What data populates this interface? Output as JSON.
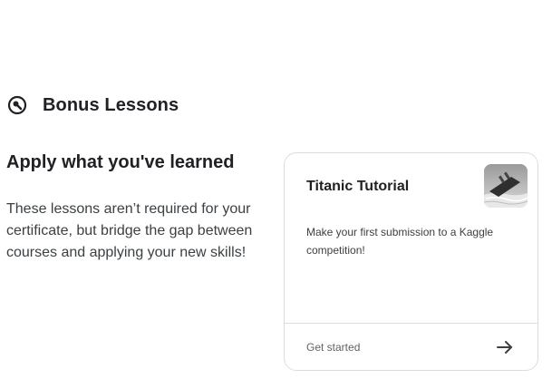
{
  "section": {
    "icon": "wrench-circle-icon",
    "title": "Bonus Lessons"
  },
  "intro": {
    "heading": "Apply what you've learned",
    "description": "These lessons aren’t required for your certificate, but bridge the gap between courses and applying your new skills!"
  },
  "card": {
    "title": "Titanic Tutorial",
    "thumbnail": "titanic-ship-thumbnail",
    "description": "Make your first submission to a Kaggle competition!",
    "cta_label": "Get started",
    "cta_icon": "arrow-right-icon"
  },
  "colors": {
    "text": "#202124",
    "muted": "#5f6368",
    "border": "#dadce0"
  }
}
